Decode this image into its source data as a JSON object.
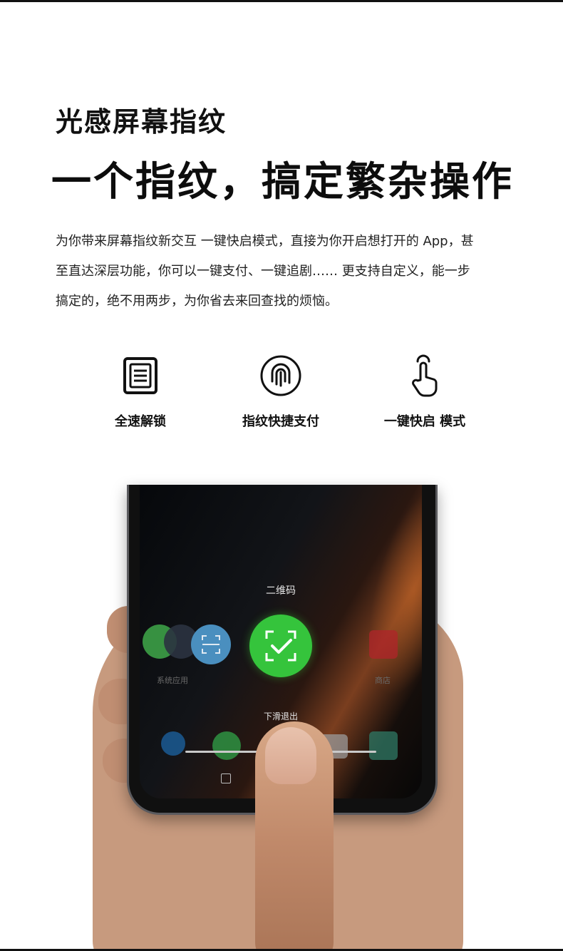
{
  "eyebrow": "光感屏幕指纹",
  "headline": "一个指纹，搞定繁杂操作",
  "description": [
    "为你带来屏幕指纹新交互 一键快启模式，直接为你开启想打开的 App，甚",
    "至直达深层功能，你可以一键支付、一键追剧…… 更支持自定义，能一步",
    "搞定的，绝不用两步，为你省去来回查找的烦恼。"
  ],
  "features": [
    {
      "icon": "document-icon",
      "label": "全速解锁"
    },
    {
      "icon": "fingerprint-icon",
      "label": "指纹快捷支付"
    },
    {
      "icon": "tap-finger-icon",
      "label": "一键快启 模式"
    }
  ],
  "phone": {
    "screen_title": "二维码",
    "left_label": "系统应用",
    "right_label": "商店",
    "exit_hint": "下滑退出",
    "accent_color": "#35c43c"
  }
}
